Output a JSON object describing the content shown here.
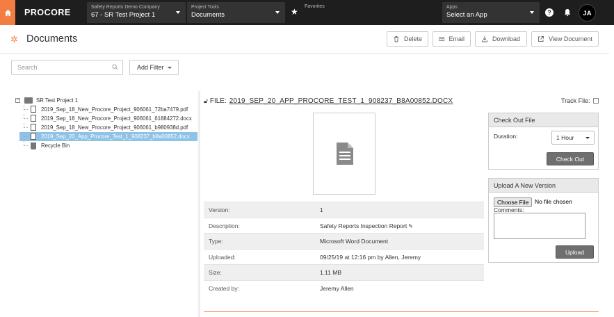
{
  "topbar": {
    "logo": "PROCORE",
    "company": {
      "label": "Safety Reports Demo Company",
      "value": "67 - SR Test Project 1"
    },
    "tools": {
      "label": "Project Tools",
      "value": "Documents"
    },
    "favorites": {
      "label": "Favorites"
    },
    "apps": {
      "label": "Apps",
      "value": "Select an App"
    },
    "help": "?",
    "avatar": "JA"
  },
  "header": {
    "title": "Documents",
    "buttons": {
      "delete": "Delete",
      "email": "Email",
      "download": "Download",
      "view": "View Document"
    }
  },
  "search": {
    "placeholder": "Search"
  },
  "filter": {
    "label": "Add Filter"
  },
  "tree": {
    "root": "SR Test Project 1",
    "toggle": "−",
    "files": [
      "2019_Sep_18_New_Procore_Project_906061_72ba7479.pdf",
      "2019_Sep_18_New_Procore_Project_906061_61884272.docx",
      "2019_Sep_18_New_Procore_Project_906061_b980938d.pdf",
      "2019_Sep_20_App_Procore_Test_1_908237_b8a00852.docx"
    ],
    "recycle": "Recycle Bin"
  },
  "file": {
    "prefix": "FILE:",
    "name": "2019_SEP_20_APP_PROCORE_TEST_1_908237_B8A00852.DOCX",
    "track_label": "Track File:"
  },
  "props": {
    "version": {
      "k": "Version:",
      "v": "1"
    },
    "description": {
      "k": "Description:",
      "v": "Safety Reports Inspection Report"
    },
    "type": {
      "k": "Type:",
      "v": "Microsoft Word Document"
    },
    "uploaded": {
      "k": "Uploaded:",
      "v": "09/25/19 at 12:16 pm by Allen, Jeremy"
    },
    "size": {
      "k": "Size:",
      "v": "1.11 MB"
    },
    "created": {
      "k": "Created by:",
      "v": "Jeremy Allen"
    }
  },
  "checkout": {
    "title": "Check Out File",
    "duration_label": "Duration:",
    "duration_value": "1 Hour",
    "button": "Check Out"
  },
  "upload": {
    "title": "Upload A New Version",
    "choose": "Choose File",
    "nofile": "No file chosen",
    "comments_label": "Comments:",
    "button": "Upload"
  },
  "colors": {
    "accent": "#f47e42",
    "topbar": "#1e1e1e",
    "selected_row": "#8ec2e6"
  }
}
